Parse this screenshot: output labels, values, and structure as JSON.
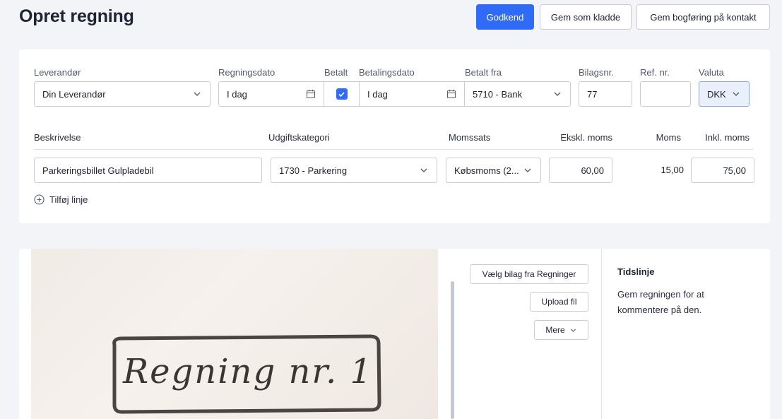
{
  "header": {
    "title": "Opret regning",
    "approve_label": "Godkend",
    "save_draft_label": "Gem som kladde",
    "save_booking_label": "Gem bogføring på kontakt"
  },
  "form": {
    "supplier": {
      "label": "Leverandør",
      "value": "Din Leverandør"
    },
    "invoice_date": {
      "label": "Regningsdato",
      "value": "I dag"
    },
    "paid": {
      "label": "Betalt",
      "checked": true
    },
    "payment_date": {
      "label": "Betalingsdato",
      "value": "I dag"
    },
    "paid_from": {
      "label": "Betalt fra",
      "value": "5710 - Bank"
    },
    "voucher_no": {
      "label": "Bilagsnr.",
      "value": "77"
    },
    "ref_no": {
      "label": "Ref. nr.",
      "value": ""
    },
    "currency": {
      "label": "Valuta",
      "value": "DKK"
    }
  },
  "lines": {
    "headers": {
      "description": "Beskrivelse",
      "category": "Udgiftskategori",
      "vat_rate": "Momssats",
      "excl_vat": "Ekskl. moms",
      "vat": "Moms",
      "incl_vat": "Inkl. moms"
    },
    "rows": [
      {
        "description": "Parkeringsbillet Gulpladebil",
        "category": "1730 - Parkering",
        "vat_rate": "Købsmoms (2...",
        "excl_vat": "60,00",
        "vat": "15,00",
        "incl_vat": "75,00"
      }
    ],
    "add_line_label": "Tilføj linje"
  },
  "attachment": {
    "image_text": "Regning nr. 1",
    "choose_label": "Vælg bilag fra Regninger",
    "upload_label": "Upload fil",
    "more_label": "Mere"
  },
  "timeline": {
    "title": "Tidslinje",
    "line1": "Gem regningen for at",
    "line2": "kommentere på den."
  },
  "colors": {
    "primary": "#2f6bf6",
    "background": "#f3f4f8"
  }
}
